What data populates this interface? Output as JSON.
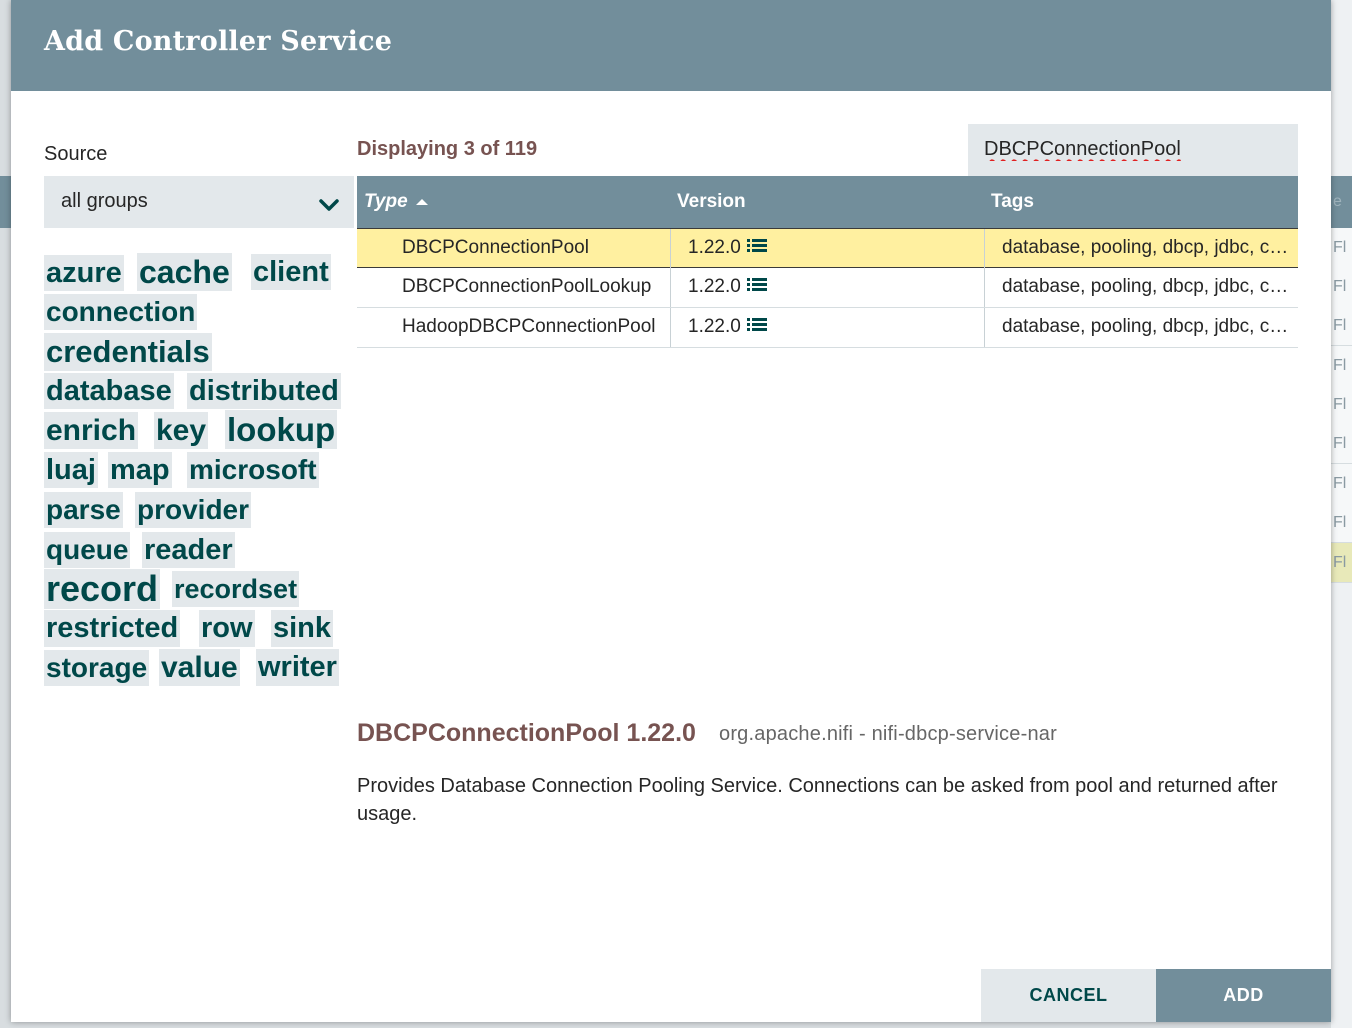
{
  "dialog": {
    "title": "Add Controller Service"
  },
  "source": {
    "label": "Source",
    "selected": "all groups"
  },
  "tags": [
    "azure",
    "cache",
    "client",
    "connection",
    "credentials",
    "database",
    "distributed",
    "enrich",
    "key",
    "lookup",
    "luaj",
    "map",
    "microsoft",
    "parse",
    "provider",
    "queue",
    "reader",
    "record",
    "recordset",
    "restricted",
    "row",
    "sink",
    "storage",
    "value",
    "writer"
  ],
  "table": {
    "displaying": "Displaying 3 of 119",
    "filter_value": "DBCPConnectionPool",
    "columns": {
      "type": "Type",
      "version": "Version",
      "tags": "Tags"
    },
    "rows": [
      {
        "type": "DBCPConnectionPool",
        "version": "1.22.0",
        "tags": "database, pooling, dbcp, jdbc, connection, store"
      },
      {
        "type": "DBCPConnectionPoolLookup",
        "version": "1.22.0",
        "tags": "database, pooling, dbcp, jdbc, connection, lookup"
      },
      {
        "type": "HadoopDBCPConnectionPool",
        "version": "1.22.0",
        "tags": "database, pooling, dbcp, jdbc, connection, hadoop"
      }
    ]
  },
  "detail": {
    "title": "DBCPConnectionPool 1.22.0",
    "bundle": "org.apache.nifi - nifi-dbcp-service-nar",
    "description": "Provides Database Connection Pooling Service. Connections can be asked from pool and returned after usage."
  },
  "buttons": {
    "cancel": "CANCEL",
    "add": "ADD"
  },
  "background": {
    "header_fragment": "e",
    "row_fragment": "Fl"
  },
  "colors": {
    "header": "#728e9b",
    "tag_text": "#004849",
    "selected_row": "#fff0a0",
    "accent_text": "#775351"
  }
}
